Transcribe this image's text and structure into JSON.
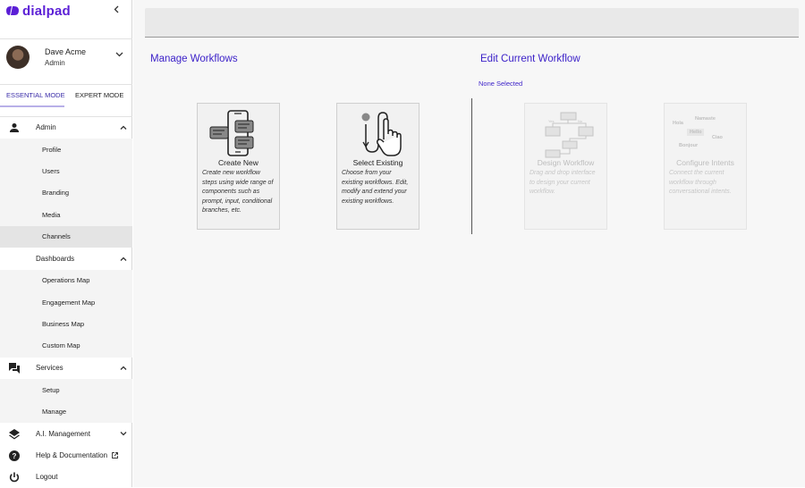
{
  "brand": {
    "name": "dialpad",
    "color": "#5b1fd6"
  },
  "sidebar": {
    "collapse_icon": "chevron-left-icon",
    "user": {
      "name": "Dave Acme",
      "role": "Admin"
    },
    "modes": {
      "essential": "ESSENTIAL MODE",
      "expert": "EXPERT MODE",
      "active": "essential"
    },
    "admin": {
      "label": "Admin",
      "items": [
        "Profile",
        "Users",
        "Branding",
        "Media",
        "Channels"
      ],
      "active_item": "Channels"
    },
    "dashboards": {
      "label": "Dashboards",
      "items": [
        "Operations Map",
        "Engagement Map",
        "Business Map",
        "Custom Map"
      ]
    },
    "services": {
      "label": "Services",
      "items": [
        "Setup",
        "Manage"
      ]
    },
    "ai_management": {
      "label": "A.I. Management"
    },
    "help": {
      "label": "Help & Documentation"
    },
    "logout": {
      "label": "Logout"
    }
  },
  "main": {
    "manage_title": "Manage Workflows",
    "edit_title": "Edit Current Workflow",
    "selection_status": "None Selected",
    "accent_color": "#3a1fc8",
    "cards": {
      "create": {
        "title": "Create New",
        "desc": "Create new workflow steps using wide range of components such as prompt, input, conditional branches, etc."
      },
      "select": {
        "title": "Select Existing",
        "desc": "Choose from your existing workflows. Edit, modify and extend your existing workflows."
      },
      "design": {
        "title": "Design Workflow",
        "desc": "Drag and drop interface to design your current workflow.",
        "diagram_labels": {
          "yes": "Yes",
          "no": "No"
        }
      },
      "intents": {
        "title": "Configure Intents",
        "desc": "Connect the current workflow through conversational intents.",
        "words": {
          "hola": "Hola",
          "namaste": "Namaste",
          "hello": "Hello",
          "ciao": "Ciao",
          "bonjour": "Bonjour"
        }
      }
    }
  }
}
